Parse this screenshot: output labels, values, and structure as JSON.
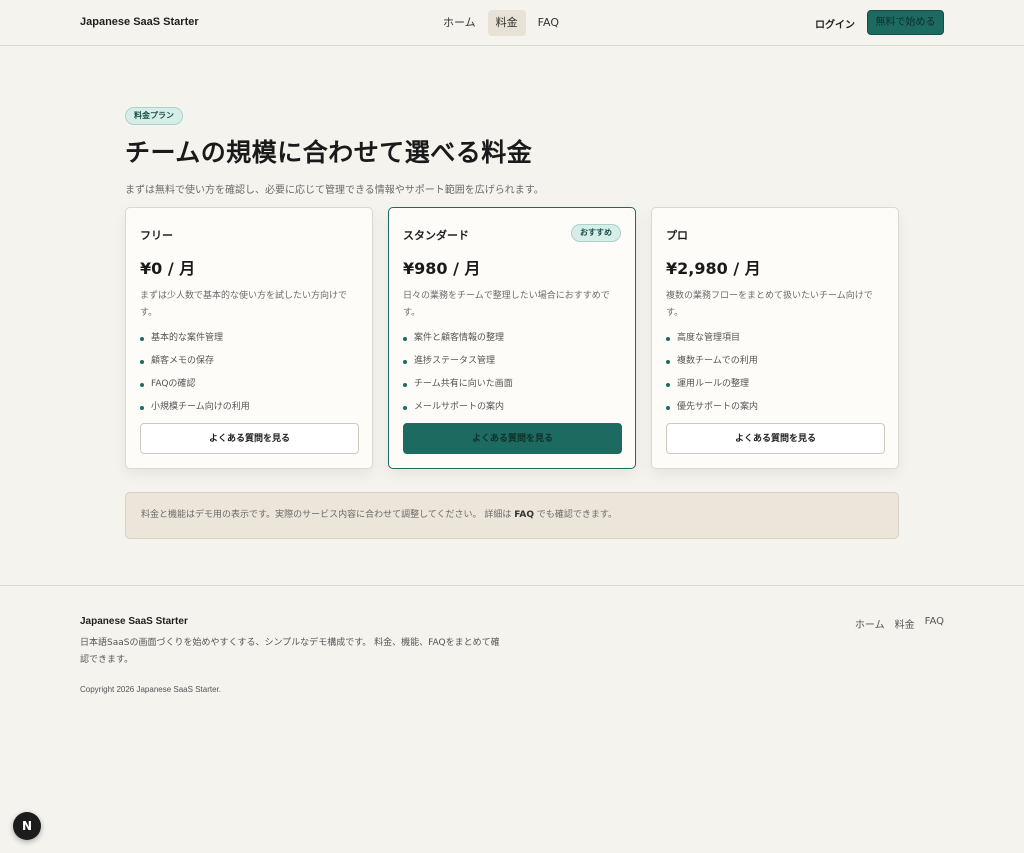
{
  "header": {
    "brand": "Japanese SaaS Starter",
    "nav": [
      "ホーム",
      "料金",
      "FAQ"
    ],
    "login": "ログイン",
    "cta": "無料で始める"
  },
  "main": {
    "badge": "料金プラン",
    "title": "チームの規模に合わせて選べる料金",
    "subtitle": "まずは無料で使い方を確認し、必要に応じて管理できる情報やサポート範囲を広げられます。",
    "plans": [
      {
        "name": "フリー",
        "price": "¥0 / 月",
        "desc": "まずは少人数で基本的な使い方を試したい方向けです。",
        "features": [
          "基本的な案件管理",
          "顧客メモの保存",
          "FAQの確認",
          "小規模チーム向けの利用"
        ],
        "button": "よくある質問を見る"
      },
      {
        "name": "スタンダード",
        "recommended": "おすすめ",
        "price": "¥980 / 月",
        "desc": "日々の業務をチームで整理したい場合におすすめです。",
        "features": [
          "案件と顧客情報の整理",
          "進捗ステータス管理",
          "チーム共有に向いた画面",
          "メールサポートの案内"
        ],
        "button": "よくある質問を見る"
      },
      {
        "name": "プロ",
        "price": "¥2,980 / 月",
        "desc": "複数の業務フローをまとめて扱いたいチーム向けです。",
        "features": [
          "高度な管理項目",
          "複数チームでの利用",
          "運用ルールの整理",
          "優先サポートの案内"
        ],
        "button": "よくある質問を見る"
      }
    ],
    "note": {
      "text": "料金と機能はデモ用の表示です。実際のサービス内容に合わせて調整してください。 詳細は ",
      "link": "FAQ",
      "suffix": " でも確認できます。"
    }
  },
  "footer": {
    "brand": "Japanese SaaS Starter",
    "desc": "日本語SaaSの画面づくりを始めやすくする、シンプルなデモ構成です。 料金、機能、FAQをまとめて確認できます。",
    "copyright": "Copyright 2026 Japanese SaaS Starter.",
    "links": [
      "ホーム",
      "料金",
      "FAQ"
    ]
  },
  "badge_icon": "N",
  "colors": {
    "accent": "#1d6b60",
    "background": "#f5f3ee"
  }
}
